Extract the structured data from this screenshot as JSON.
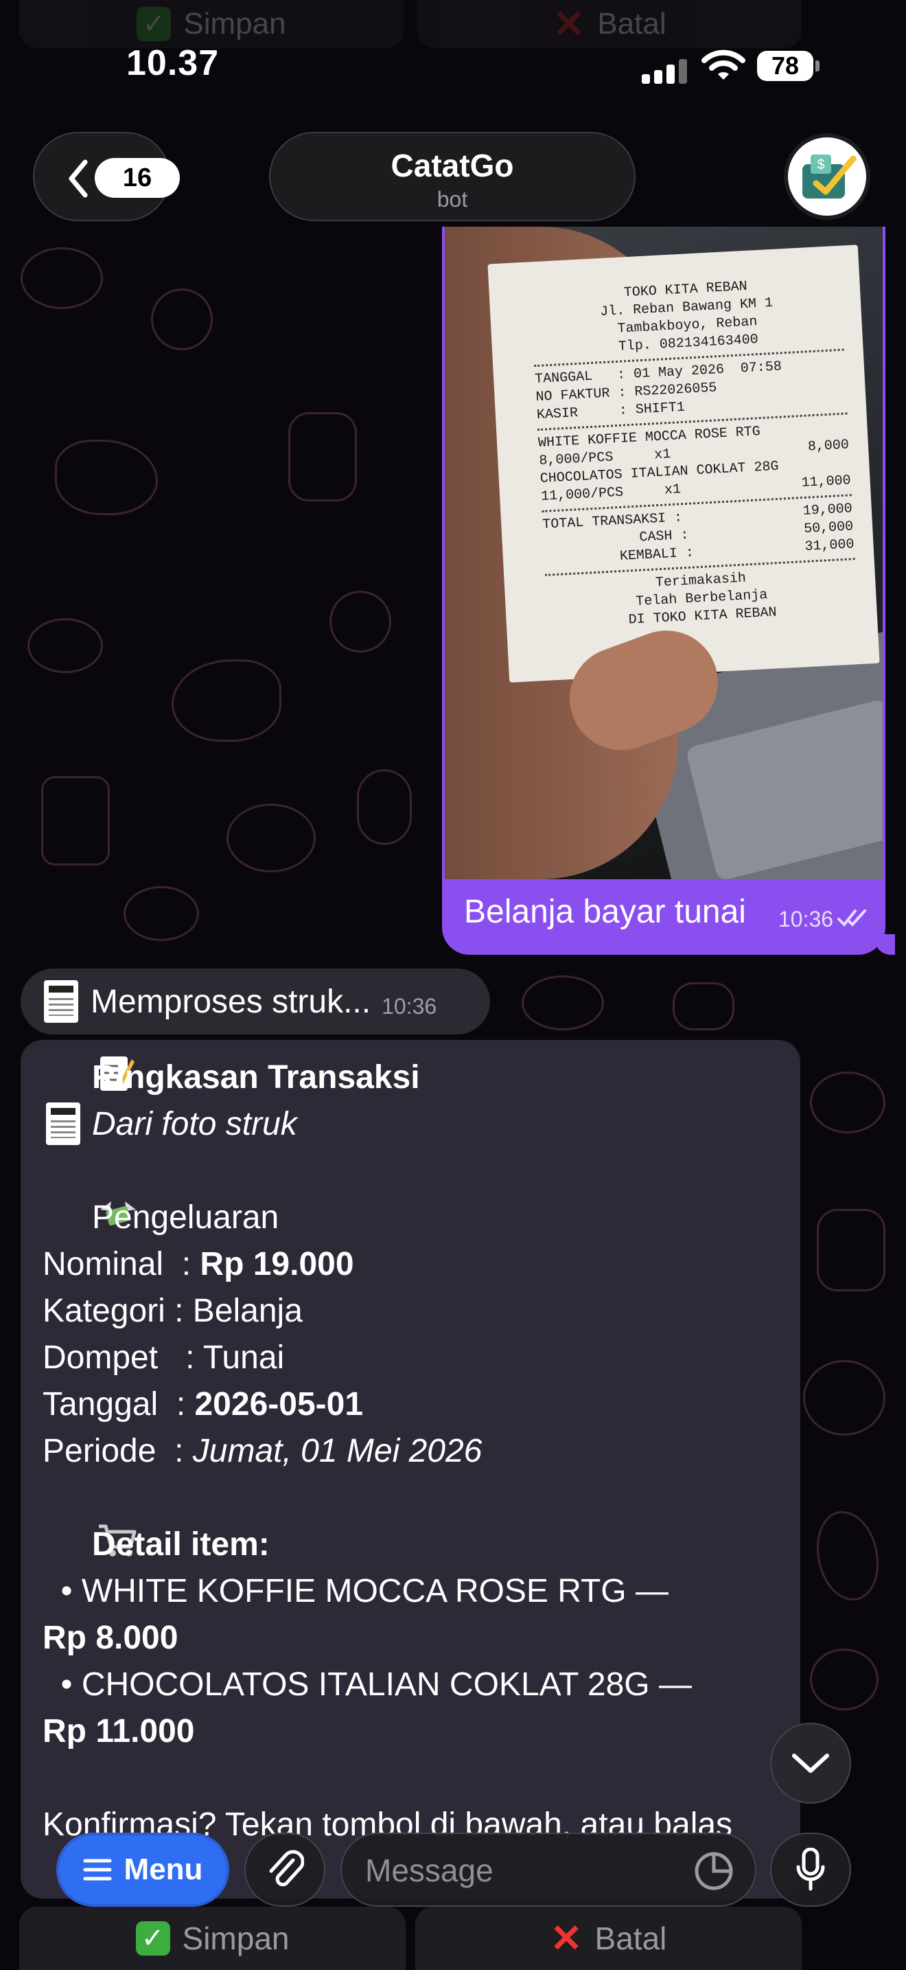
{
  "status_bar": {
    "time": "10.37",
    "battery": "78"
  },
  "header": {
    "back_count": "16",
    "title": "CatatGo",
    "subtitle": "bot"
  },
  "receipt_photo": {
    "store": "TOKO KITA REBAN",
    "address1": "Jl. Reban Bawang KM 1",
    "address2": "Tambakboyo, Reban",
    "phone": "Tlp. 082134163400",
    "date_row": "TANGGAL   : 01 May 2026  07:58",
    "invoice_row": "NO FAKTUR : RS22026055",
    "cashier_row": "KASIR     : SHIFT1",
    "item1_name": "WHITE KOFFIE MOCCA ROSE RTG",
    "item1_qty": "8,000/PCS     x1",
    "item1_total": "8,000",
    "item2_name": "CHOCOLATOS ITALIAN COKLAT 28G",
    "item2_qty": "11,000/PCS     x1",
    "item2_total": "11,000",
    "total_label": "TOTAL TRANSAKSI :",
    "total_val": "19,000",
    "cash_label": "CASH :",
    "cash_val": "50,000",
    "change_label": "KEMBALI :",
    "change_val": "31,000",
    "thanks1": "Terimakasih",
    "thanks2": "Telah Berbelanja",
    "thanks3": "DI TOKO KITA REBAN"
  },
  "outgoing": {
    "caption": "Belanja bayar tunai",
    "time": "10:36"
  },
  "processing": {
    "text": "Memproses struk...",
    "time": "10:36"
  },
  "summary": {
    "title": "Ringkasan Transaksi",
    "subtitle": "Dari foto struk",
    "section": "Pengeluaran",
    "nominal_label": "Nominal  : ",
    "nominal_value": "Rp 19.000",
    "kategori": "Kategori : Belanja",
    "dompet": "Dompet   : Tunai",
    "tanggal_label": "Tanggal  : ",
    "tanggal_value": "2026-05-01",
    "periode_label": "Periode  : ",
    "periode_value": "Jumat, 01 Mei 2026",
    "detail_title": "Detail item:",
    "item1": "  • WHITE KOFFIE MOCCA ROSE RTG —",
    "item1_price": "Rp 8.000",
    "item2": "  • CHOCOLATOS ITALIAN COKLAT 28G —",
    "item2_price": "Rp 11.000",
    "confirm": "Konfirmasi? Tekan tombol di bawah, atau balas"
  },
  "buttons": {
    "save": "Simpan",
    "cancel": "Batal"
  },
  "input": {
    "menu": "Menu",
    "placeholder": "Message"
  },
  "colors": {
    "accent_purple": "#8b4ff0",
    "menu_blue": "#2f6ef2",
    "incoming_bubble": "#302c3a"
  }
}
